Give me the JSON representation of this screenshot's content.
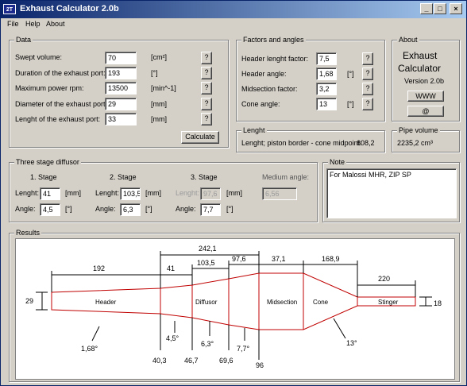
{
  "app": {
    "title": "Exhaust Calculator 2.0b",
    "icon_text": "2T"
  },
  "window_buttons": {
    "minimize": "_",
    "maximize": "□",
    "close": "×"
  },
  "menu": [
    "File",
    "Help",
    "About"
  ],
  "data_panel": {
    "label": "Data",
    "rows": [
      {
        "label": "Swept volume:",
        "value": "70",
        "unit": "[cm²]",
        "help": "?"
      },
      {
        "label": "Duration of the exhaust port:",
        "value": "193",
        "unit": "[°]",
        "help": "?"
      },
      {
        "label": "Maximum power rpm:",
        "value": "13500",
        "unit": "[min^-1]",
        "help": "?"
      },
      {
        "label": "Diameter of the exhaust port:",
        "value": "29",
        "unit": "[mm]",
        "help": "?"
      },
      {
        "label": "Lenght of the exhaust port:",
        "value": "33",
        "unit": "[mm]",
        "help": "?"
      }
    ],
    "calculate": "Calculate"
  },
  "factors_panel": {
    "label": "Factors and angles",
    "rows": [
      {
        "label": "Header lenght factor:",
        "value": "7,5",
        "unit": "",
        "help": "?"
      },
      {
        "label": "Header angle:",
        "value": "1,68",
        "unit": "[°]",
        "help": "?"
      },
      {
        "label": "Midsection factor:",
        "value": "3,2",
        "unit": "",
        "help": "?"
      },
      {
        "label": "Cone angle:",
        "value": "13",
        "unit": "[°]",
        "help": "?"
      }
    ]
  },
  "about_panel": {
    "label": "About",
    "line1": "Exhaust",
    "line2": "Calculator",
    "version": "Version 2.0b",
    "www": "WWW",
    "mail": "@"
  },
  "length_panel": {
    "label": "Lenght",
    "text": "Lenght; piston border - cone midpoint:",
    "value": "608,2"
  },
  "pipe_panel": {
    "label": "Pipe volume",
    "value": "2235,2 cm³"
  },
  "diffusor_panel": {
    "label": "Three stage diffusor",
    "stages": [
      {
        "title": "1. Stage",
        "length_label": "Lenght:",
        "length": "41",
        "length_unit": "[mm]",
        "angle_label": "Angle:",
        "angle": "4,5",
        "angle_unit": "[°]"
      },
      {
        "title": "2. Stage",
        "length_label": "Lenght:",
        "length": "103,5",
        "length_unit": "[mm]",
        "angle_label": "Angle:",
        "angle": "6,3",
        "angle_unit": "[°]"
      },
      {
        "title": "3. Stage",
        "length_label": "Lenght:",
        "length": "97,6",
        "length_unit": "[mm]",
        "angle_label": "Angle:",
        "angle": "7,7",
        "angle_unit": "[°]"
      }
    ],
    "medium_label": "Medium angle:",
    "medium_value": "6,56"
  },
  "note_panel": {
    "label": "Note",
    "text": "For Malossi MHR, ZIP SP"
  },
  "results": {
    "label": "Results",
    "sections": [
      "Header",
      "Diffusor",
      "Midsection",
      "Cone",
      "Stinger"
    ],
    "dims_top": [
      "192",
      "41",
      "103,5",
      "97,6",
      "37,1",
      "168,9",
      "242,1",
      "220"
    ],
    "diam_left": "29",
    "diam_right": "18",
    "positions": [
      "40,3",
      "46,7",
      "69,6",
      "96"
    ],
    "angles": [
      "1,68°",
      "4,5°",
      "6,3°",
      "7,7°",
      "13°"
    ]
  }
}
